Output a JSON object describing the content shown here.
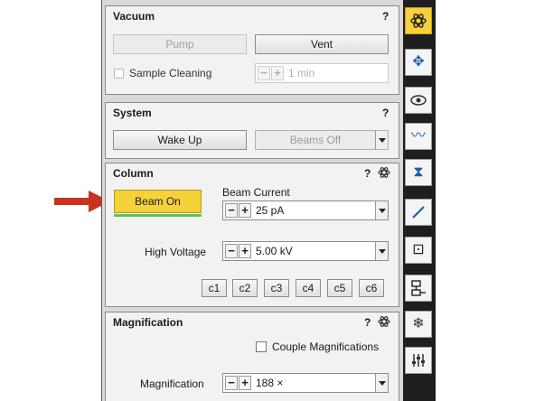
{
  "vacuum": {
    "title": "Vacuum",
    "help": "?",
    "pump_label": "Pump",
    "vent_label": "Vent",
    "sample_cleaning_label": "Sample Cleaning",
    "cleaning_time": "1 min"
  },
  "system": {
    "title": "System",
    "help": "?",
    "wake_up_label": "Wake Up",
    "beams_off_label": "Beams Off"
  },
  "column": {
    "title": "Column",
    "help": "?",
    "beam_on_label": "Beam On",
    "beam_current_label": "Beam Current",
    "beam_current_value": "25 pA",
    "high_voltage_label": "High Voltage",
    "high_voltage_value": "5.00 kV",
    "presets": [
      "c1",
      "c2",
      "c3",
      "c4",
      "c5",
      "c6"
    ]
  },
  "magnification": {
    "title": "Magnification",
    "help": "?",
    "couple_label": "Couple Magnifications",
    "mag_label": "Magnification",
    "mag_value": "188 ×"
  },
  "stepper": {
    "minus": "−",
    "plus": "+"
  },
  "colors": {
    "beam_on": "#f5d13a",
    "arrow": "#c8321e",
    "toolbar_active": "#f5d13a",
    "indicator": "#5cc25c"
  },
  "toolbar_icons": [
    "atom-icon",
    "stage-icon",
    "eye-icon",
    "wave-icon",
    "hourglass-icon",
    "needle-icon",
    "focus-target-icon",
    "workflow-icon",
    "snowflake-icon",
    "sliders-icon"
  ]
}
